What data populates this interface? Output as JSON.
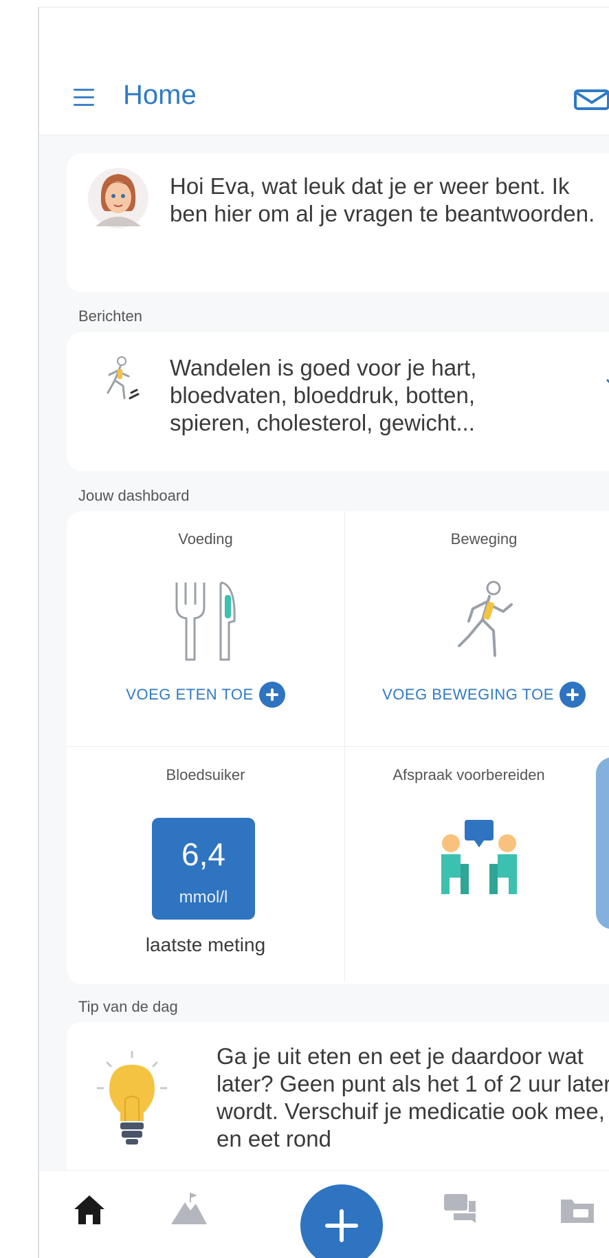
{
  "header": {
    "title": "Home"
  },
  "greeting": {
    "text": "Hoi Eva, wat leuk dat je er weer bent. Ik ben hier om al je vragen te beantwoorden."
  },
  "messages": {
    "section_label": "Berichten",
    "text": "Wandelen is goed voor  je hart, bloedvaten, bloeddruk, botten, spieren, cholesterol, gewicht..."
  },
  "dashboard": {
    "section_label": "Jouw dashboard",
    "voeding": {
      "title": "Voeding",
      "action": "VOEG ETEN TOE"
    },
    "beweging": {
      "title": "Beweging",
      "action": "VOEG BEWEGING TOE"
    },
    "bloedsuiker": {
      "title": "Bloedsuiker",
      "value": "6,4",
      "unit": "mmol/l",
      "caption": "laatste meting"
    },
    "afspraak": {
      "title": "Afspraak voorbereiden"
    }
  },
  "tip": {
    "section_label": "Tip van de dag",
    "text": "Ga je uit eten en eet je daardoor wat later? Geen punt als het 1 of 2 uur later wordt. Verschuif je medicatie ook mee, en eet rond"
  },
  "bottom_nav": {
    "items": [
      "home-icon",
      "mountain-icon",
      "add-icon",
      "chat-icon",
      "folder-icon"
    ]
  },
  "colors": {
    "accent": "#2f74c0",
    "title_blue": "#2f7ac4",
    "teal": "#3cc1b0",
    "yellow": "#f5c342"
  }
}
